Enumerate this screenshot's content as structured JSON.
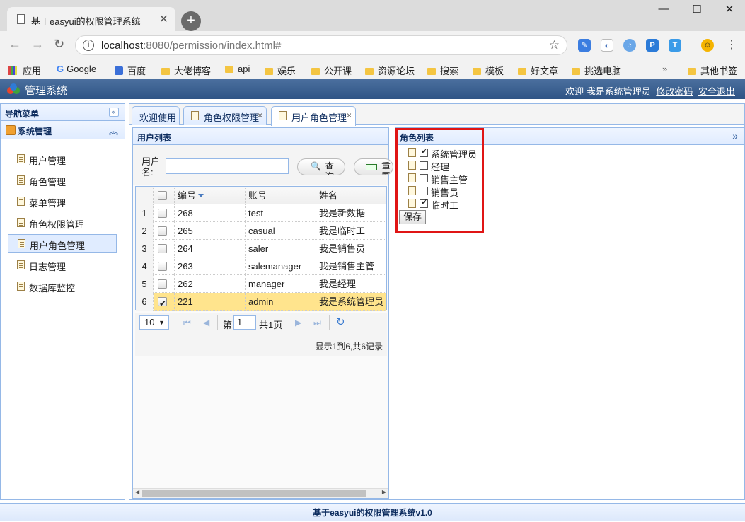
{
  "browser": {
    "tab_title": "基于easyui的权限管理系统",
    "tab_close": "✕",
    "new_tab": "+",
    "minimize": "—",
    "maximize": "☐",
    "close": "✕",
    "url_host": "localhost",
    "url_rest": ":8080/permission/index.html#",
    "bookmarks": {
      "apps": "应用",
      "google": "Google",
      "baidu": "百度",
      "b1": "大佬博客",
      "b2": "api",
      "b3": "娱乐",
      "b4": "公开课",
      "b5": "资源论坛",
      "b6": "搜索",
      "b7": "模板",
      "b8": "好文章",
      "b9": "挑选电脑",
      "more": "»",
      "other": "其他书签"
    }
  },
  "app": {
    "title": "管理系统",
    "welcome": "欢迎 我是系统管理员",
    "change_password": "修改密码",
    "logout": "安全退出",
    "footer": "基于easyui的权限管理系统v1.0"
  },
  "nav": {
    "title": "导航菜单",
    "collapse": "«",
    "group": "系统管理",
    "group_chevron": "︽",
    "items": [
      {
        "label": "用户管理"
      },
      {
        "label": "角色管理"
      },
      {
        "label": "菜单管理"
      },
      {
        "label": "角色权限管理"
      },
      {
        "label": "用户角色管理"
      },
      {
        "label": "日志管理"
      },
      {
        "label": "数据库监控"
      }
    ]
  },
  "tabs": [
    {
      "label": "欢迎使用"
    },
    {
      "label": "角色权限管理",
      "close": "×"
    },
    {
      "label": "用户角色管理",
      "close": "×"
    }
  ],
  "user_panel": {
    "title": "用户列表",
    "search_label": "用户名:",
    "search_value": "",
    "query_button": "查询",
    "reset_button": "重置",
    "columns": [
      "编号",
      "账号",
      "姓名"
    ],
    "rows": [
      {
        "n": "1",
        "id": "268",
        "account": "test",
        "name": "我是新数据",
        "checked": false
      },
      {
        "n": "2",
        "id": "265",
        "account": "casual",
        "name": "我是临时工",
        "checked": false
      },
      {
        "n": "3",
        "id": "264",
        "account": "saler",
        "name": "我是销售员",
        "checked": false
      },
      {
        "n": "4",
        "id": "263",
        "account": "salemanager",
        "name": "我是销售主管",
        "checked": false
      },
      {
        "n": "5",
        "id": "262",
        "account": "manager",
        "name": "我是经理",
        "checked": false
      },
      {
        "n": "6",
        "id": "221",
        "account": "admin",
        "name": "我是系统管理员",
        "checked": true
      }
    ],
    "pager": {
      "page_size": "10",
      "page_prefix": "第",
      "page_number": "1",
      "page_total": "共1页",
      "info": "显示1到6,共6记录"
    }
  },
  "role_panel": {
    "title": "角色列表",
    "expand": "»",
    "roles": [
      {
        "label": "系统管理员",
        "checked": true
      },
      {
        "label": "经理",
        "checked": false
      },
      {
        "label": "销售主管",
        "checked": false
      },
      {
        "label": "销售员",
        "checked": false
      },
      {
        "label": "临时工",
        "checked": true
      }
    ],
    "save_button": "保存"
  }
}
